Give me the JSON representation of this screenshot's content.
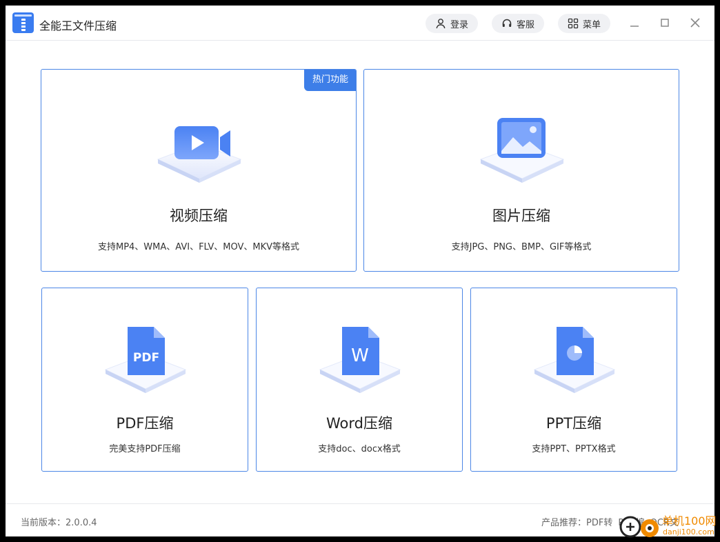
{
  "app": {
    "title": "全能王文件压缩"
  },
  "toolbar": {
    "login_label": "登录",
    "service_label": "客服",
    "menu_label": "菜单"
  },
  "cards": {
    "video": {
      "title": "视频压缩",
      "desc": "支持MP4、WMA、AVI、FLV、MOV、MKV等格式",
      "badge": "热门功能"
    },
    "image": {
      "title": "图片压缩",
      "desc": "支持JPG、PNG、BMP、GIF等格式"
    },
    "pdf": {
      "title": "PDF压缩",
      "desc": "完美支持PDF压缩",
      "icon_text": "PDF"
    },
    "word": {
      "title": "Word压缩",
      "desc": "支持doc、docx格式",
      "icon_text": "W"
    },
    "ppt": {
      "title": "PPT压缩",
      "desc": "支持PPT、PPTX格式"
    }
  },
  "footer": {
    "version_label": "当前版本：",
    "version_value": "2.0.0.4",
    "recommend_label": "产品推荐：",
    "recommend_items": [
      "PDF转",
      "PDF编",
      "OCR文"
    ]
  },
  "watermark": {
    "text": "单机100网",
    "url": "danji100.com"
  },
  "colors": {
    "accent": "#3d7ee8",
    "card_border": "#4b86e6",
    "icon_blue": "#5b8ff5"
  }
}
